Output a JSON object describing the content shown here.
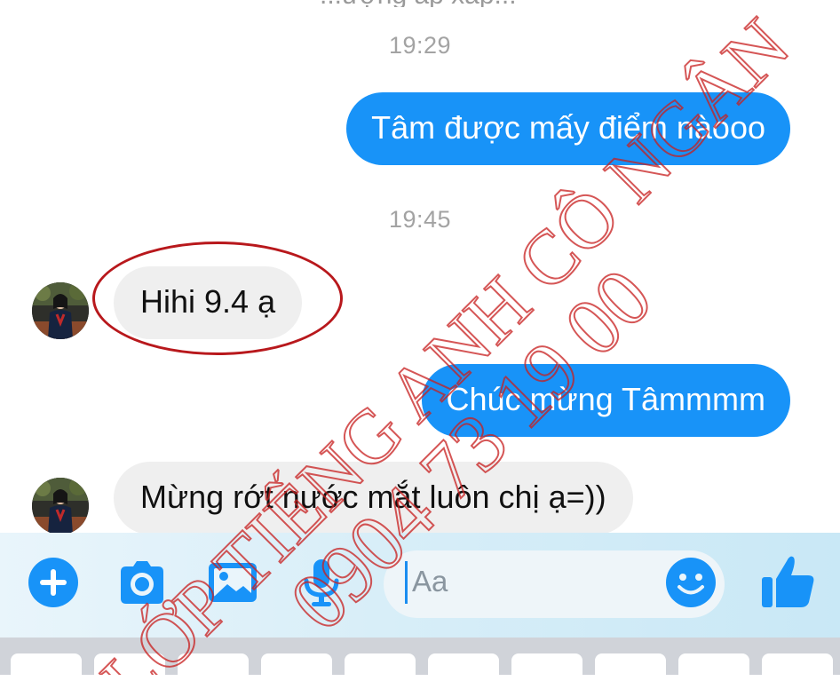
{
  "conversation": {
    "cut_off_text": "...ượng ấp xấp...",
    "messages": [
      {
        "type": "timestamp",
        "text": "19:29"
      },
      {
        "type": "outgoing",
        "text": "Tâm được mấy điểm nàooo"
      },
      {
        "type": "timestamp",
        "text": "19:45"
      },
      {
        "type": "incoming",
        "text": "Hihi 9.4 ạ"
      },
      {
        "type": "outgoing",
        "text": "Chúc mừng Tâmmmm"
      },
      {
        "type": "incoming",
        "text": "Mừng rớt nước mắt luôn chị ạ=))"
      }
    ]
  },
  "composer": {
    "placeholder": "Aa",
    "icons": [
      "plus-icon",
      "camera-icon",
      "image-icon",
      "microphone-icon",
      "emoji-icon",
      "thumbs-up-icon"
    ],
    "accent_color": "#1893f8"
  },
  "watermark": {
    "line1": "LỚP TIẾNG ANH CÔ NGÂN",
    "line2": "0904 73 19 00",
    "color": "#c81e1e"
  },
  "colors": {
    "outgoing_bubble": "#1893f8",
    "incoming_bubble": "#efefef",
    "highlight_ring": "#b8181c"
  }
}
